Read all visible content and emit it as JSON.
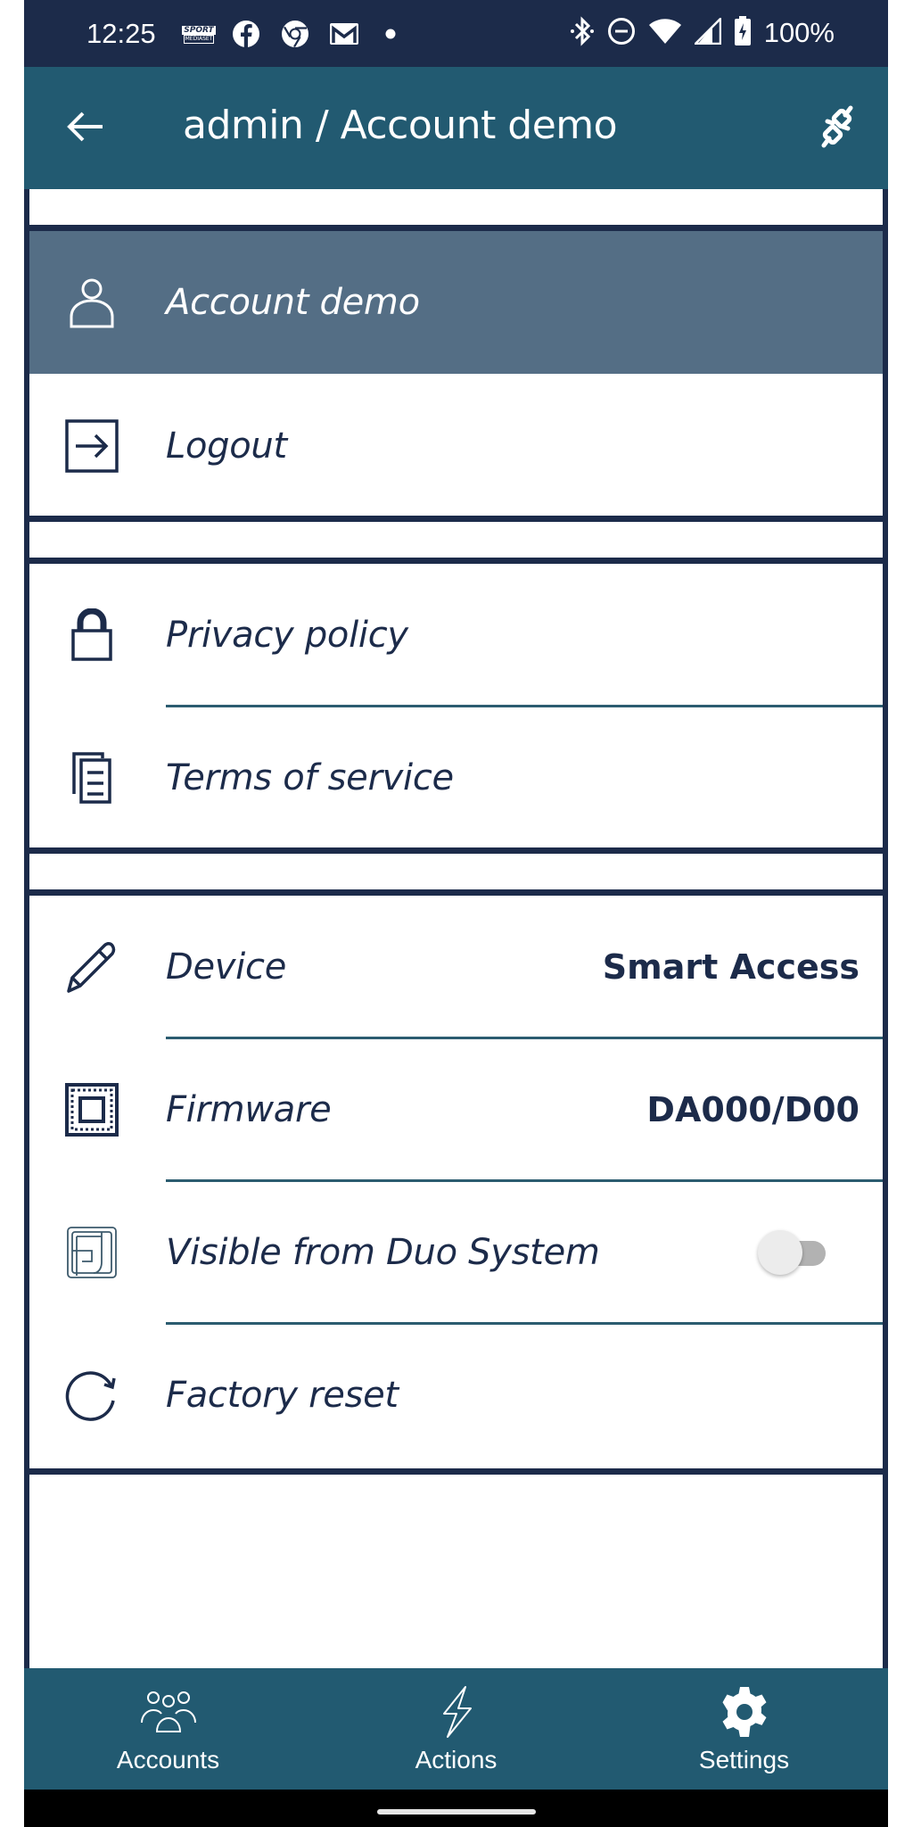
{
  "status_bar": {
    "time": "12:25",
    "notification_icons": [
      "sport-mediaset-icon",
      "facebook-icon",
      "chrome-icon",
      "gmail-icon",
      "dot-icon"
    ],
    "system_icons": [
      "bluetooth-icon",
      "do-not-disturb-icon",
      "wifi-icon",
      "cellular-signal-icon",
      "battery-charging-icon"
    ],
    "battery": "100%",
    "sport_label_top": "SPORT",
    "sport_label_bottom": "MEDIASET"
  },
  "header": {
    "title": "admin / Account demo",
    "back_icon": "arrow-left-icon",
    "action_icon": "plug-disconnect-icon"
  },
  "colors": {
    "header": "#225a71",
    "status_bar": "#1c2b4a",
    "selected_row": "#546e85",
    "text": "#1c2b4a",
    "separator": "#2b5c70"
  },
  "sections": {
    "account": {
      "items": [
        {
          "label": "Account demo",
          "icon": "person-icon",
          "selected": true
        },
        {
          "label": "Logout",
          "icon": "logout-icon"
        }
      ]
    },
    "legal": {
      "items": [
        {
          "label": "Privacy policy",
          "icon": "lock-icon"
        },
        {
          "label": "Terms of service",
          "icon": "documents-icon"
        }
      ]
    },
    "device": {
      "items": [
        {
          "label": "Device",
          "icon": "pencil-icon",
          "value": "Smart Access"
        },
        {
          "label": "Firmware",
          "icon": "chip-icon",
          "value": "DA000/D00"
        },
        {
          "label": "Visible from Duo System",
          "icon": "duo-system-icon",
          "toggle": false
        },
        {
          "label": "Factory reset",
          "icon": "refresh-icon"
        }
      ]
    }
  },
  "bottom_nav": {
    "items": [
      {
        "label": "Accounts",
        "icon": "users-icon"
      },
      {
        "label": "Actions",
        "icon": "lightning-icon"
      },
      {
        "label": "Settings",
        "icon": "gear-icon",
        "active": true
      }
    ]
  }
}
